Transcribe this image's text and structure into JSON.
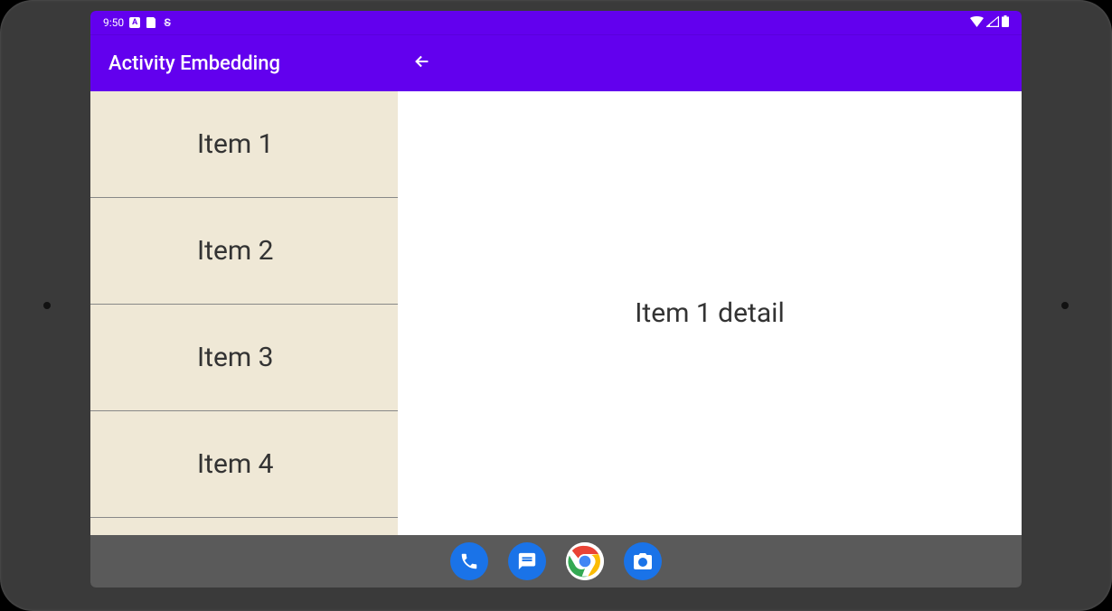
{
  "status_bar": {
    "time": "9:50",
    "keyboard_indicator": "A",
    "strikethrough_indicator": "S"
  },
  "app_bar": {
    "title": "Activity Embedding"
  },
  "list": {
    "items": [
      {
        "label": "Item 1"
      },
      {
        "label": "Item 2"
      },
      {
        "label": "Item 3"
      },
      {
        "label": "Item 4"
      }
    ]
  },
  "detail": {
    "content": "Item 1 detail"
  },
  "nav_bar": {
    "icons": [
      {
        "name": "phone"
      },
      {
        "name": "messages"
      },
      {
        "name": "chrome"
      },
      {
        "name": "camera"
      }
    ]
  }
}
